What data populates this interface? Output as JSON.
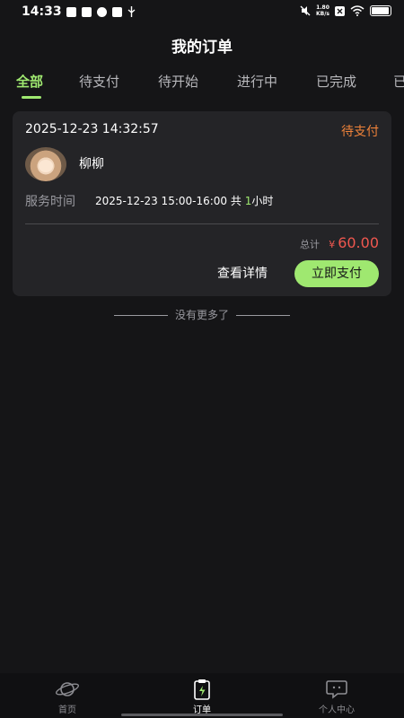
{
  "status_bar": {
    "time": "14:33",
    "net_speed_value": "1.80",
    "net_speed_unit": "KB/s",
    "battery_label": "battery-icon"
  },
  "header": {
    "title": "我的订单"
  },
  "tabs": [
    {
      "label": "全部",
      "active": true
    },
    {
      "label": "待支付"
    },
    {
      "label": "待开始"
    },
    {
      "label": "进行中"
    },
    {
      "label": "已完成"
    },
    {
      "label": "已"
    }
  ],
  "order": {
    "datetime": "2025-12-23 14:32:57",
    "status": "待支付",
    "staff_name": "柳柳",
    "service_time_label": "服务时间",
    "service_time_range": "2025-12-23 15:00-16:00",
    "service_total_prefix": "共",
    "service_hours": "1",
    "service_hours_unit": "小时",
    "total_label": "总计",
    "currency": "¥",
    "total_amount": "60.00",
    "detail_button": "查看详情",
    "pay_button": "立即支付"
  },
  "list_footer": {
    "no_more": "没有更多了"
  },
  "bottom_nav": [
    {
      "label": "首页",
      "icon": "planet-icon"
    },
    {
      "label": "订单",
      "icon": "clipboard-bolt-icon",
      "active": true
    },
    {
      "label": "个人中心",
      "icon": "chat-face-icon"
    }
  ],
  "colors": {
    "accent": "#9fe870",
    "status": "#f0833a",
    "price": "#f0574f",
    "background": "#151517",
    "card": "#242427"
  }
}
